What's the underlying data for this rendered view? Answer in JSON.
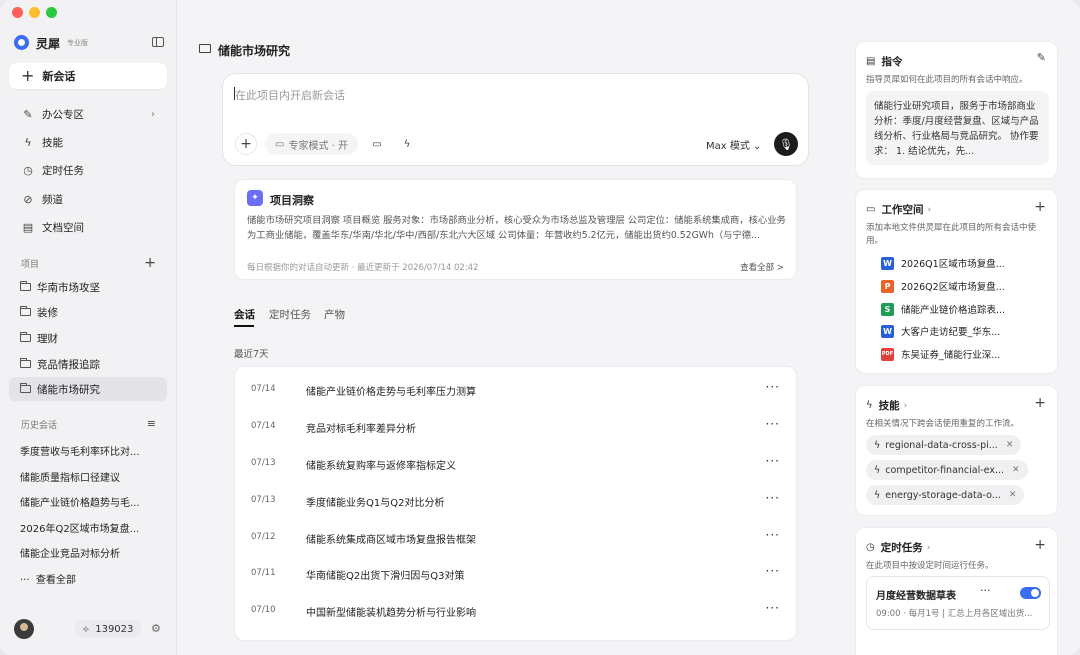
{
  "app": {
    "name": "灵犀",
    "edition": "专业版"
  },
  "colors": {
    "accent": "#3a6cf4",
    "traffic_red": "#fe5f57",
    "traffic_yellow": "#febc2e",
    "traffic_green": "#28c840"
  },
  "sidebar": {
    "new_chat": "新会话",
    "nav": [
      {
        "label": "办公专区",
        "icon": "pen-icon"
      },
      {
        "label": "技能",
        "icon": "bolt-icon"
      },
      {
        "label": "定时任务",
        "icon": "clock-icon"
      },
      {
        "label": "频道",
        "icon": "channel-icon"
      },
      {
        "label": "文档空间",
        "icon": "document-icon"
      }
    ],
    "projects_label": "项目",
    "projects": [
      "华南市场攻坚",
      "装修",
      "理财",
      "竞品情报追踪",
      "储能市场研究"
    ],
    "history_label": "历史会话",
    "history": [
      "季度营收与毛利率环比对...",
      "储能质量指标口径建议",
      "储能产业链价格趋势与毛...",
      "2026年Q2区域市场复盘...",
      "储能企业竞品对标分析"
    ],
    "view_all": "查看全部",
    "credits": "139023"
  },
  "main": {
    "title": "储能市场研究",
    "composer": {
      "placeholder": "在此项目内开启新会话",
      "expert": "专家模式 · 开",
      "mode": "Max 模式"
    },
    "insight": {
      "title": "项目洞察",
      "body": "储能市场研究项目洞察 项目概览 服务对象：市场部商业分析，核心受众为市场总监及管理层 公司定位：储能系统集成商，核心业务为工商业储能，覆盖华东/华南/华北/华中/西部/东北六大区域 公司体量：年营收约5.2亿元，储能出货约0.52GWh（与宁德...",
      "footer": "每日根据你的对话自动更新 · 最近更新于 2026/07/14 02:42",
      "view_all": "查看全部 >"
    },
    "tabs": [
      "会话",
      "定时任务",
      "产物"
    ],
    "recent_label": "最近7天",
    "sessions": [
      {
        "date": "07/14",
        "title": "储能产业链价格走势与毛利率压力测算"
      },
      {
        "date": "07/14",
        "title": "竞品对标毛利率差异分析"
      },
      {
        "date": "07/13",
        "title": "储能系统复购率与返修率指标定义"
      },
      {
        "date": "07/13",
        "title": "季度储能业务Q1与Q2对比分析"
      },
      {
        "date": "07/12",
        "title": "储能系统集成商区域市场复盘报告框架"
      },
      {
        "date": "07/11",
        "title": "华南储能Q2出货下滑归因与Q3对策"
      },
      {
        "date": "07/10",
        "title": "中国新型储能装机趋势分析与行业影响"
      }
    ]
  },
  "panel": {
    "instructions": {
      "title": "指令",
      "sub": "指导灵犀如何在此项目的所有会话中响应。",
      "text": "储能行业研究项目，服务于市场部商业分析：季度/月度经营复盘、区域与产品线分析、行业格局与竞品研究。 协作要求： 1. 结论优先，先..."
    },
    "workspace": {
      "title": "工作空间",
      "sub": "添加本地文件供灵犀在此项目的所有会话中使用。",
      "files": [
        {
          "name": "2026Q1区域市场复盘...",
          "type": "W",
          "color": "#2b5fd9"
        },
        {
          "name": "2026Q2区域市场复盘...",
          "type": "P",
          "color": "#e8632b"
        },
        {
          "name": "储能产业链价格追踪表...",
          "type": "S",
          "color": "#1f9d55"
        },
        {
          "name": "大客户走访纪要_华东...",
          "type": "W",
          "color": "#2b5fd9"
        },
        {
          "name": "东吴证券_储能行业深...",
          "type": "PDF",
          "color": "#e0413a"
        }
      ]
    },
    "skills": {
      "title": "技能",
      "sub": "在相关情况下跨会话使用重复的工作流。",
      "items": [
        "regional-data-cross-pi...",
        "competitor-financial-ex...",
        "energy-storage-data-o..."
      ]
    },
    "schedule": {
      "title": "定时任务",
      "sub": "在此项目中按设定时间运行任务。",
      "task": {
        "title": "月度经营数据草表",
        "meta": "09:00 · 每月1号 | 汇总上月各区域出货..."
      }
    }
  }
}
